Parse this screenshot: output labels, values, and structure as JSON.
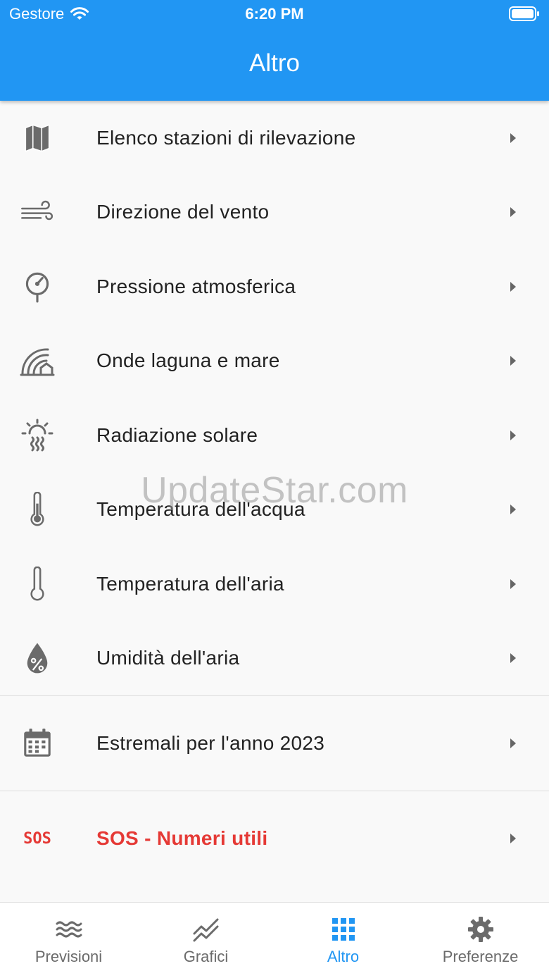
{
  "status_bar": {
    "carrier": "Gestore",
    "time": "6:20 PM"
  },
  "header": {
    "title": "Altro"
  },
  "menu": {
    "items": [
      {
        "label": "Elenco stazioni di rilevazione",
        "icon": "map-icon"
      },
      {
        "label": "Direzione del vento",
        "icon": "wind-icon"
      },
      {
        "label": "Pressione atmosferica",
        "icon": "barometer-icon"
      },
      {
        "label": "Onde laguna e mare",
        "icon": "waves-icon"
      },
      {
        "label": "Radiazione solare",
        "icon": "solar-radiation-icon"
      },
      {
        "label": "Temperatura dell'acqua",
        "icon": "water-thermometer-icon"
      },
      {
        "label": "Temperatura dell'aria",
        "icon": "air-thermometer-icon"
      },
      {
        "label": "Umidità dell'aria",
        "icon": "humidity-icon"
      }
    ],
    "extremes": {
      "label": "Estremali per l'anno 2023",
      "icon": "calendar-icon"
    },
    "sos": {
      "label": "SOS - Numeri utili",
      "icon_text": "SOS",
      "color": "#e53935"
    }
  },
  "watermark": "UpdateStar.com",
  "tabbar": {
    "tabs": [
      {
        "label": "Previsioni",
        "icon": "waves-icon",
        "active": false
      },
      {
        "label": "Grafici",
        "icon": "chart-line-icon",
        "active": false
      },
      {
        "label": "Altro",
        "icon": "grid-icon",
        "active": true
      },
      {
        "label": "Preferenze",
        "icon": "gear-icon",
        "active": false
      }
    ]
  },
  "colors": {
    "primary": "#2196f3",
    "sos": "#e53935",
    "icon_gray": "#6b6b6b"
  }
}
